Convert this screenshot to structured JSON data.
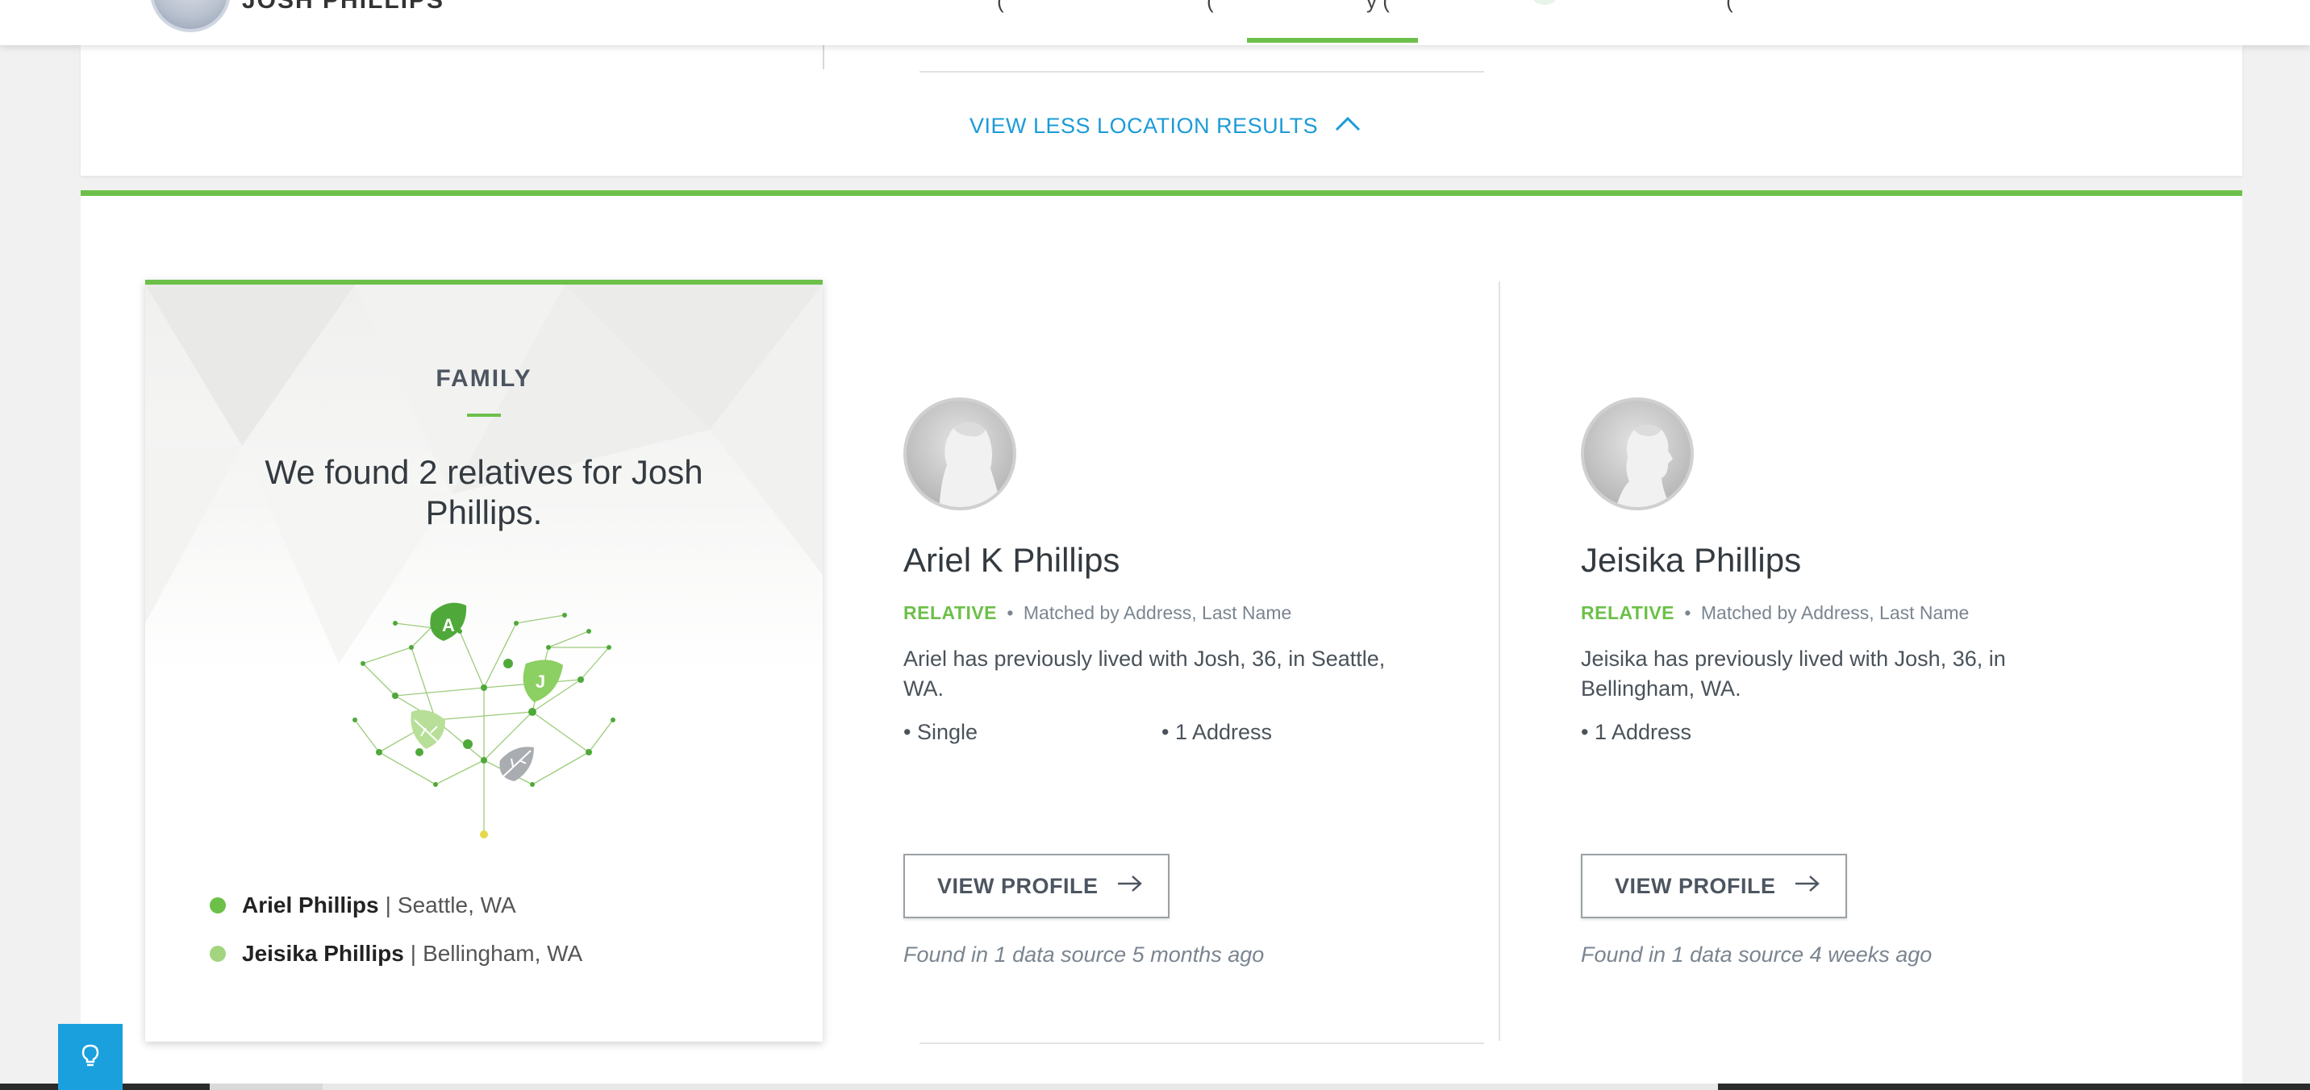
{
  "header": {
    "name_partial": "JOSH PHILLIPS",
    "tab_stubs": [
      "(",
      "(",
      "y (",
      "(",
      "("
    ]
  },
  "locations": {
    "view_less_label": "VIEW LESS LOCATION RESULTS"
  },
  "family": {
    "title": "FAMILY",
    "headline": "We found 2 relatives for Josh Phillips.",
    "tree_leaves": [
      "A",
      "J"
    ],
    "relatives": [
      {
        "name": "Ariel Phillips",
        "separator": "|",
        "location": "Seattle, WA",
        "color": "#6cc049"
      },
      {
        "name": "Jeisika Phillips",
        "separator": "|",
        "location": "Bellingham, WA",
        "color": "#a3d57f"
      }
    ]
  },
  "people": [
    {
      "name": "Ariel K Phillips",
      "tag": "RELATIVE",
      "bullet": "•",
      "match": "Matched by Address, Last Name",
      "description": "Ariel has previously lived with Josh, 36, in Seattle, WA.",
      "facts": [
        "• Single",
        "• 1 Address"
      ],
      "button_label": "VIEW PROFILE",
      "found": "Found in 1 data source 5 months ago"
    },
    {
      "name": "Jeisika Phillips",
      "tag": "RELATIVE",
      "bullet": "•",
      "match": "Matched by Address, Last Name",
      "description": "Jeisika has previously lived with Josh, 36, in Bellingham, WA.",
      "facts": [
        "• 1 Address"
      ],
      "button_label": "VIEW PROFILE",
      "found": "Found in 1 data source 4 weeks ago"
    }
  ],
  "colors": {
    "accent_green": "#6cc049",
    "link_blue": "#1b9bd7",
    "tip_blue": "#1aa0dd"
  },
  "icons": {
    "chevron": "chevron-up-icon",
    "arrow": "arrow-right-icon",
    "tip": "lightbulb-icon"
  }
}
